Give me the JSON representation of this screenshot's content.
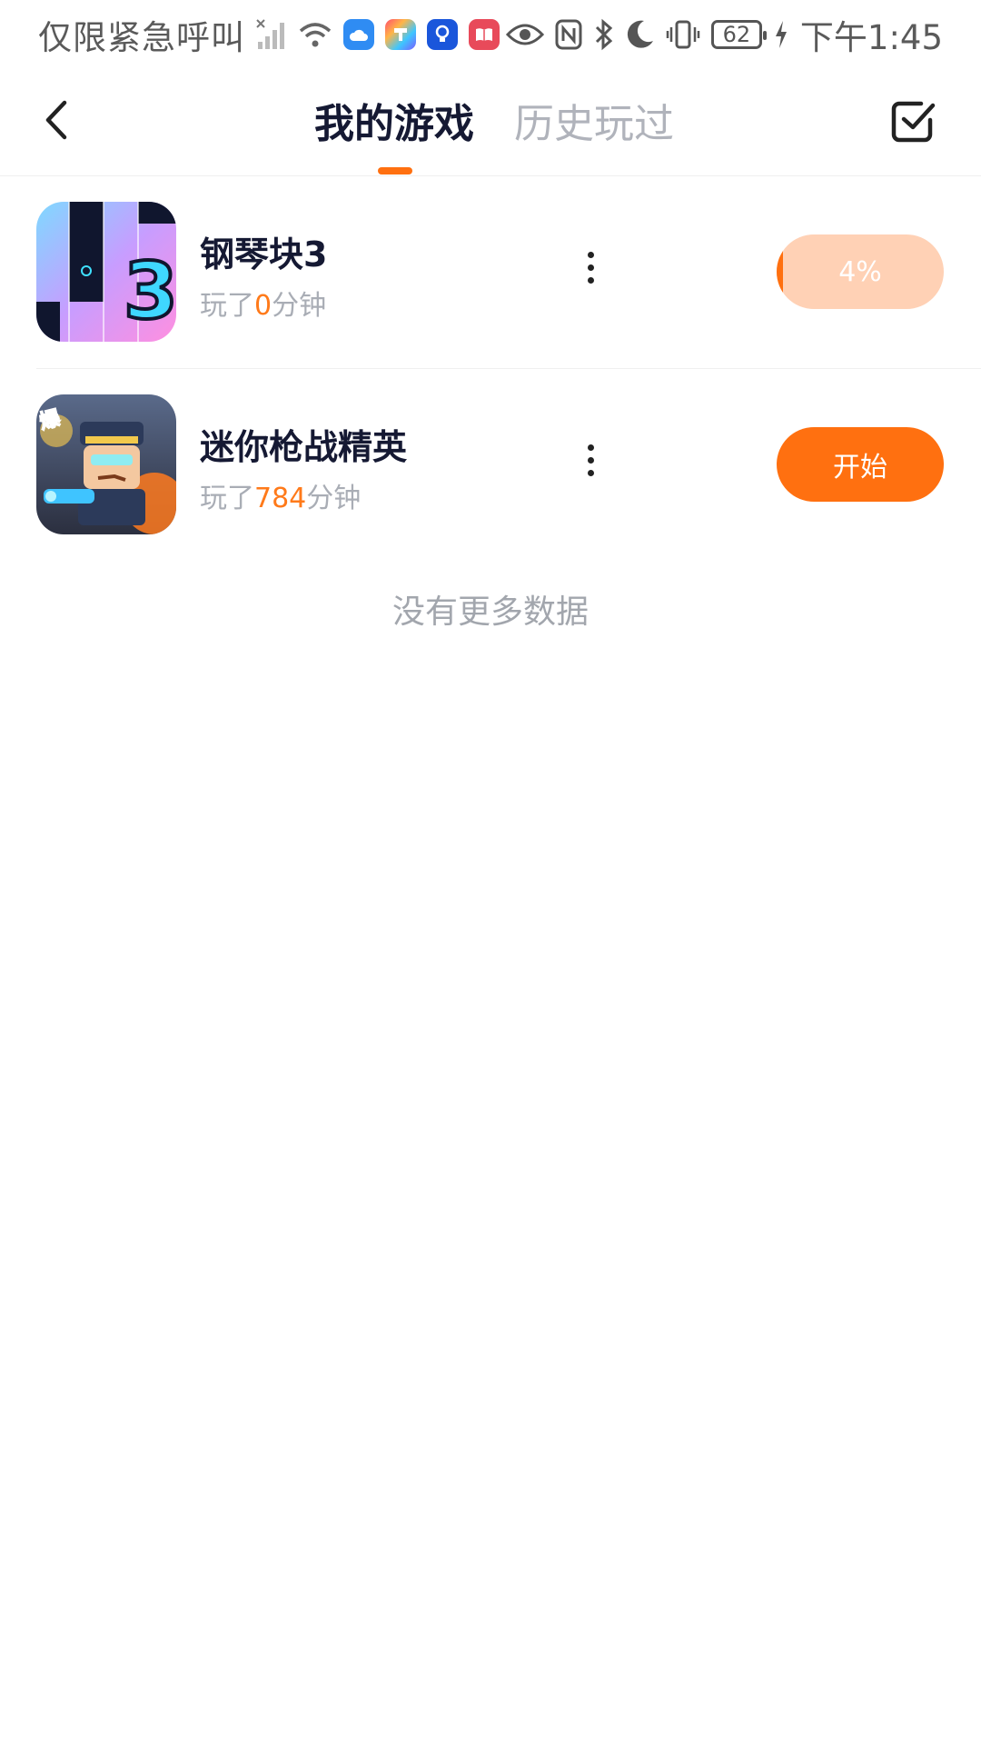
{
  "status_bar": {
    "carrier": "仅限紧急呼叫",
    "battery": "62",
    "time": "下午1:45"
  },
  "header": {
    "tabs": [
      {
        "label": "我的游戏",
        "active": true
      },
      {
        "label": "历史玩过",
        "active": false
      }
    ]
  },
  "games": [
    {
      "title": "钢琴块3",
      "played_prefix": "玩了",
      "played_value": "0",
      "played_suffix": "分钟",
      "action": {
        "type": "progress",
        "label": "4%",
        "progress": 0.04
      }
    },
    {
      "title": "迷你枪战精英",
      "played_prefix": "玩了",
      "played_value": "784",
      "played_suffix": "分钟",
      "action": {
        "type": "start",
        "label": "开始"
      }
    }
  ],
  "footer": {
    "no_more": "没有更多数据"
  },
  "colors": {
    "accent": "#ff7010",
    "accent_light": "#ffd1b5",
    "title": "#151933",
    "muted": "#a9adb5"
  }
}
